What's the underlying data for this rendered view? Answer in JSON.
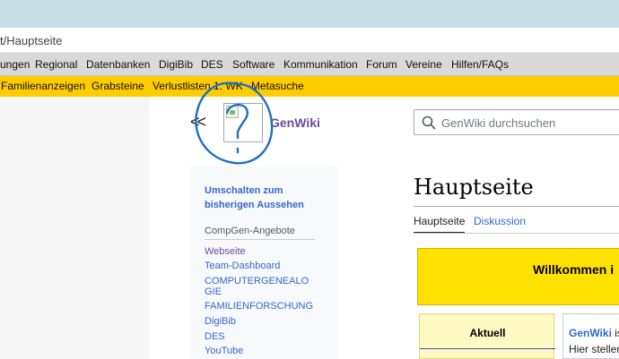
{
  "browser": {
    "url_prefix": "t/",
    "url_path": "Hauptseite"
  },
  "nav_main": [
    "ungen",
    "Regional",
    "Datenbanken",
    "DigiBib",
    "DES",
    "Software",
    "Kommunikation",
    "Forum",
    "Vereine",
    "Hilfen/FAQs"
  ],
  "nav_secondary": [
    "Familienanzeigen",
    "Grabsteine",
    "Verlustlisten 1. WK",
    "Metasuche"
  ],
  "header": {
    "collapse_label": "<<",
    "site_name": "GenWiki",
    "search_placeholder": "GenWiki durchsuchen",
    "search_icon": "search-icon",
    "logo_icon": "broken-image-icon"
  },
  "sidebar": {
    "toggle_label": "Umschalten zum bisherigen Aussehen",
    "section_heading": "CompGen-Angebote",
    "links": [
      "Webseite",
      "Team-Dashboard",
      "COMPUTERGENEALOGIE",
      "FAMILIENFORSCHUNG",
      "DigiBib",
      "DES",
      "YouTube"
    ]
  },
  "content": {
    "title": "Hauptseite",
    "tabs": [
      "Hauptseite",
      "Diskussion"
    ],
    "welcome_text": "Willkommen i",
    "aktuell_heading": "Aktuell",
    "intro_name": "GenWiki",
    "intro_rest": " is",
    "intro_line2": "Hier steller"
  },
  "colors": {
    "nav_secondary_bg": "#ffcc00",
    "welcome_bg": "#ffe100",
    "link": "#3366cc",
    "visited_link": "#6b4ba1",
    "annotation_stroke": "#1f6fc4"
  }
}
